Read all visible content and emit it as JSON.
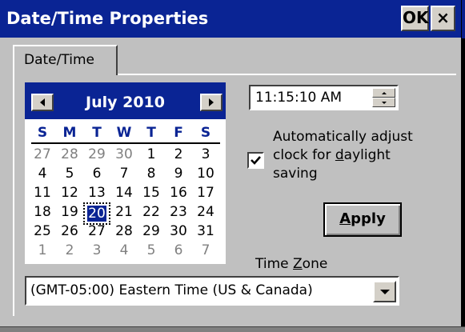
{
  "window": {
    "title": "Date/Time Properties",
    "ok_label": "OK",
    "close_label": "×"
  },
  "tabs": [
    {
      "label": "Date/Time",
      "selected": true
    }
  ],
  "calendar": {
    "month_label": "July 2010",
    "weekday_headers": [
      "S",
      "M",
      "T",
      "W",
      "T",
      "F",
      "S"
    ],
    "weeks": [
      [
        "27",
        "28",
        "29",
        "30",
        "1",
        "2",
        "3"
      ],
      [
        "4",
        "5",
        "6",
        "7",
        "8",
        "9",
        "10"
      ],
      [
        "11",
        "12",
        "13",
        "14",
        "15",
        "16",
        "17"
      ],
      [
        "18",
        "19",
        "20",
        "21",
        "22",
        "23",
        "24"
      ],
      [
        "25",
        "26",
        "27",
        "28",
        "29",
        "30",
        "31"
      ],
      [
        "1",
        "2",
        "3",
        "4",
        "5",
        "6",
        "7"
      ]
    ],
    "selected_day": "20",
    "colors": {
      "header_bg": "#0a2494",
      "selected_bg": "#0a2494",
      "other_month": "#808080"
    }
  },
  "time": {
    "value": "11:15:10 AM"
  },
  "dst": {
    "checked": true,
    "line1": "Automatically adjust",
    "line2_pre": "clock for ",
    "line2_underline": "d",
    "line2_post": "aylight",
    "line3": "saving"
  },
  "apply": {
    "label_underline": "A",
    "label_rest": "pply"
  },
  "timezone": {
    "label_pre": "Time ",
    "label_underline": "Z",
    "label_post": "one",
    "selected": "(GMT-05:00) Eastern Time (US & Canada)"
  },
  "icons": {
    "prev_month": "triangle-left-icon",
    "next_month": "triangle-right-icon",
    "spin_up": "triangle-up-icon",
    "spin_down": "triangle-down-icon",
    "dropdown": "triangle-down-icon",
    "checkmark": "checkmark-icon"
  }
}
